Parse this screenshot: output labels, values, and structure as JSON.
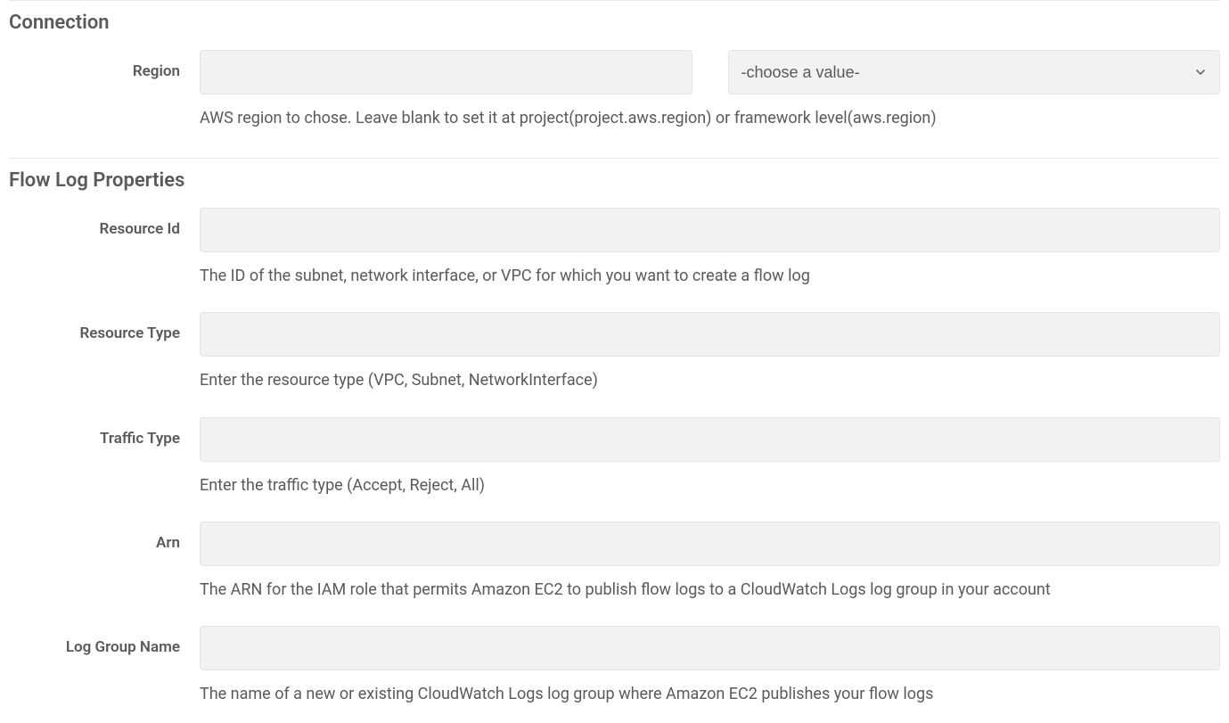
{
  "sections": {
    "connection": {
      "title": "Connection",
      "fields": {
        "region": {
          "label": "Region",
          "value": "",
          "select_placeholder": "-choose a value-",
          "help": "AWS region to chose. Leave blank to set it at project(project.aws.region) or framework level(aws.region)"
        }
      }
    },
    "flow_log": {
      "title": "Flow Log Properties",
      "fields": {
        "resource_id": {
          "label": "Resource Id",
          "value": "",
          "help": "The ID of the subnet, network interface, or VPC for which you want to create a flow log"
        },
        "resource_type": {
          "label": "Resource Type",
          "value": "",
          "help": "Enter the resource type (VPC, Subnet, NetworkInterface)"
        },
        "traffic_type": {
          "label": "Traffic Type",
          "value": "",
          "help": "Enter the traffic type (Accept, Reject, All)"
        },
        "arn": {
          "label": "Arn",
          "value": "",
          "help": "The ARN for the IAM role that permits Amazon EC2 to publish flow logs to a CloudWatch Logs log group in your account"
        },
        "log_group_name": {
          "label": "Log Group Name",
          "value": "",
          "help": "The name of a new or existing CloudWatch Logs log group where Amazon EC2 publishes your flow logs"
        }
      }
    }
  }
}
